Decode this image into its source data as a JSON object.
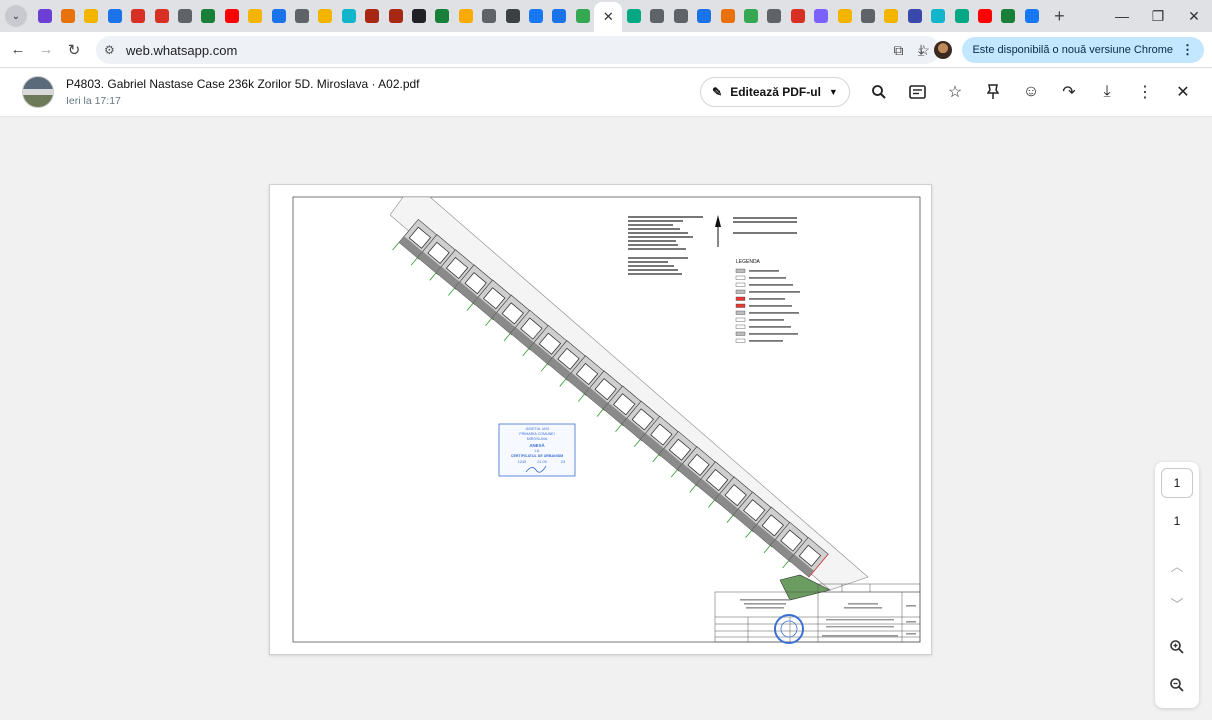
{
  "browser": {
    "tabs": [
      {
        "icon": "arrow-icon",
        "color": "#6b3fd4"
      },
      {
        "icon": "pin-icon",
        "color": "#e8710a"
      },
      {
        "icon": "tool-icon",
        "color": "#f4b400"
      },
      {
        "icon": "circle-icon",
        "color": "#1a73e8"
      },
      {
        "icon": "mail-icon",
        "color": "#d93025"
      },
      {
        "icon": "pdf-icon",
        "color": "#d93025"
      },
      {
        "icon": "globe-icon",
        "color": "#5f6368"
      },
      {
        "icon": "plus-icon",
        "color": "#188038"
      },
      {
        "icon": "youtube-icon",
        "color": "#ff0000"
      },
      {
        "icon": "tool-icon",
        "color": "#f4b400"
      },
      {
        "icon": "box-icon",
        "color": "#1a73e8"
      },
      {
        "icon": "globe-icon",
        "color": "#5f6368"
      },
      {
        "icon": "tool-icon",
        "color": "#f4b400"
      },
      {
        "icon": "square-icon",
        "color": "#12b5cb"
      },
      {
        "icon": "ball-icon",
        "color": "#a52714"
      },
      {
        "icon": "ball-icon",
        "color": "#a52714"
      },
      {
        "icon": "letter-icon",
        "color": "#202124"
      },
      {
        "icon": "puzzle-icon",
        "color": "#188038"
      },
      {
        "icon": "puzzle-icon",
        "color": "#f9ab00"
      },
      {
        "icon": "gear-icon",
        "color": "#5f6368"
      },
      {
        "icon": "chat-icon",
        "color": "#3c4043"
      },
      {
        "icon": "facebook-icon",
        "color": "#1877f2"
      },
      {
        "icon": "pdf-icon",
        "color": "#1a73e8"
      },
      {
        "icon": "maps-icon",
        "color": "#34a853"
      }
    ],
    "tabs_after": [
      {
        "icon": "whatsapp-icon",
        "color": "#00a884"
      },
      {
        "icon": "globe-icon",
        "color": "#5f6368"
      },
      {
        "icon": "globe-icon",
        "color": "#5f6368"
      },
      {
        "icon": "box-icon",
        "color": "#1a73e8"
      },
      {
        "icon": "pin-icon",
        "color": "#e8710a"
      },
      {
        "icon": "maps-icon",
        "color": "#34a853"
      },
      {
        "icon": "globe-icon",
        "color": "#5f6368"
      },
      {
        "icon": "record-icon",
        "color": "#d93025"
      },
      {
        "icon": "mail-icon",
        "color": "#7b61ff"
      },
      {
        "icon": "tool-icon",
        "color": "#f4b400"
      },
      {
        "icon": "globe-icon",
        "color": "#5f6368"
      },
      {
        "icon": "tool-icon",
        "color": "#f4b400"
      },
      {
        "icon": "shield-icon",
        "color": "#3949ab"
      },
      {
        "icon": "square-icon",
        "color": "#12b5cb"
      },
      {
        "icon": "whatsapp-icon",
        "color": "#00a884"
      },
      {
        "icon": "youtube-icon",
        "color": "#ff0000"
      },
      {
        "icon": "chart-icon",
        "color": "#188038"
      },
      {
        "icon": "facebook-icon",
        "color": "#1877f2"
      }
    ],
    "url": "web.whatsapp.com",
    "update_label": "Este disponibilă o nouă versiune Chrome"
  },
  "viewer": {
    "title": "P4803. Gabriel Nastase Case 236k Zorilor 5D. Miroslava · A02.pdf",
    "subtitle": "Ieri la 17:17",
    "edit_label": "Editează PDF-ul",
    "current_page": "1",
    "total_pages": "1"
  },
  "document": {
    "legend_title": "LEGENDA",
    "stamp": {
      "line1": "JUDETUL IASI",
      "line2": "PRIMARIA COMUNEI",
      "line3": "MIROSLAVA",
      "line4": "ANEXĂ",
      "line5": "LA",
      "line6": "CERTIFICATUL DE URBANISM",
      "number": "1249",
      "date": "21.09",
      "year": "23"
    },
    "accent": "#e53935",
    "parcel_color": "#8a8a8a"
  }
}
